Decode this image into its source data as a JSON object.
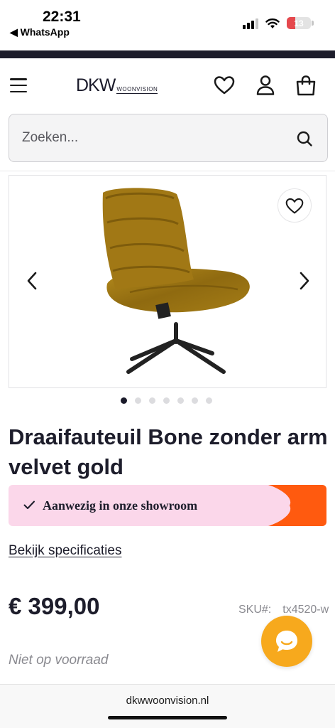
{
  "status_bar": {
    "time": "22:31",
    "back_app": "◀ WhatsApp",
    "battery": "13"
  },
  "header": {
    "logo_main": "DKW",
    "logo_sub": "WOONVISION",
    "icons": [
      "menu-icon",
      "heart-icon",
      "user-icon",
      "shopping-bag-icon"
    ]
  },
  "search": {
    "placeholder": "Zoeken..."
  },
  "gallery": {
    "total_images": 7,
    "active_index": 0
  },
  "product": {
    "title": "Draaifauteuil Bone zonder arm velvet gold",
    "showroom_label": "Aanwezig in onze showroom",
    "spec_link": "Bekijk specificaties",
    "price": "€ 399,00",
    "sku_label": "SKU#:",
    "sku_value": "tx4520-w",
    "stock_status": "Niet op voorraad"
  },
  "browser": {
    "url": "dkwwoonvision.nl"
  },
  "colors": {
    "brand_dark": "#1d1d2b",
    "banner_pink": "#fbd7ea",
    "banner_orange": "#ff5a0f",
    "chat_orange": "#f7a91d"
  }
}
